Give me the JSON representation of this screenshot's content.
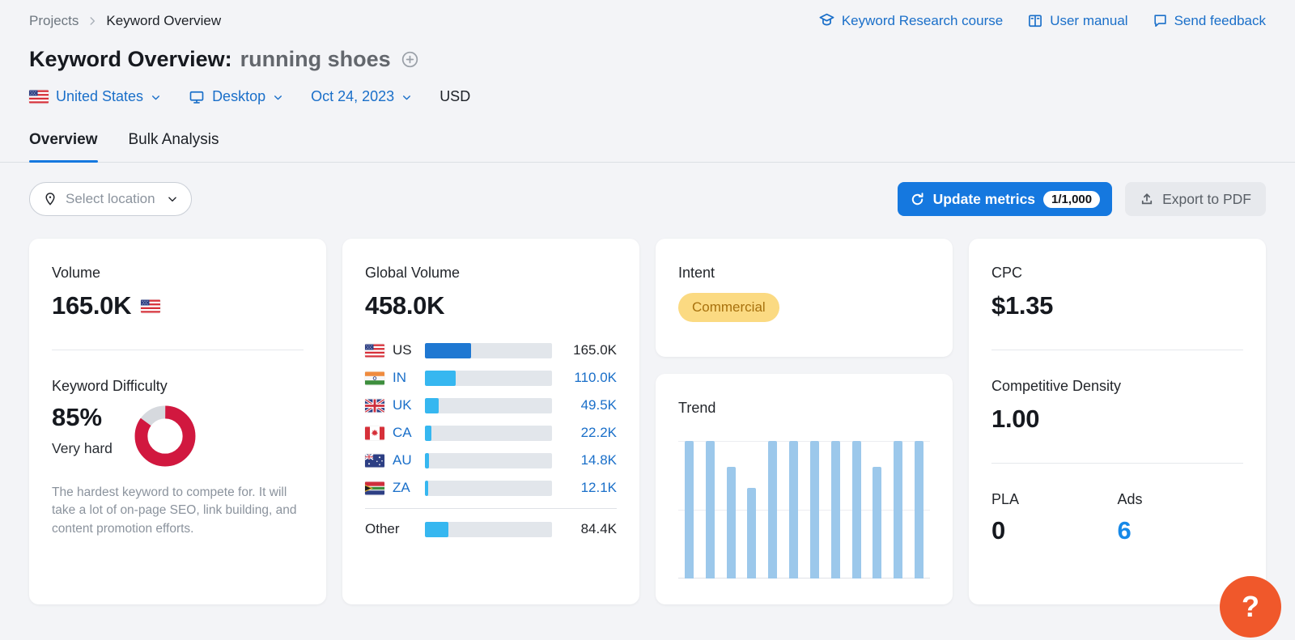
{
  "breadcrumb": {
    "items": [
      {
        "label": "Projects"
      },
      {
        "label": "Keyword Overview"
      }
    ]
  },
  "header_links": [
    {
      "label": "Keyword Research course",
      "icon": "graduation-cap-icon"
    },
    {
      "label": "User manual",
      "icon": "book-icon"
    },
    {
      "label": "Send feedback",
      "icon": "chat-bubble-icon"
    }
  ],
  "title": {
    "prefix": "Keyword Overview:",
    "keyword": "running shoes"
  },
  "filters": {
    "location": {
      "label": "United States",
      "flag": "us"
    },
    "device": {
      "label": "Desktop"
    },
    "date": {
      "label": "Oct 24, 2023"
    },
    "currency": {
      "label": "USD"
    }
  },
  "tabs": [
    {
      "label": "Overview",
      "active": true
    },
    {
      "label": "Bulk Analysis",
      "active": false
    }
  ],
  "toolbar": {
    "select_location": {
      "placeholder": "Select location"
    },
    "update_metrics": {
      "label": "Update metrics",
      "counter": "1/1,000"
    },
    "export_pdf": {
      "label": "Export to PDF"
    }
  },
  "cards": {
    "volume": {
      "title": "Volume",
      "value": "165.0K",
      "flag": "us"
    },
    "keyword_difficulty": {
      "title": "Keyword Difficulty",
      "percent": "85%",
      "level": "Very hard",
      "description": "The hardest keyword to compete for. It will take a lot of on-page SEO, link building, and content promotion efforts."
    },
    "global_volume": {
      "title": "Global Volume",
      "value": "458.0K",
      "rows": [
        {
          "code": "US",
          "flag": "us",
          "value": "165.0K",
          "fraction": 0.36,
          "dark_bar": true,
          "link": false
        },
        {
          "code": "IN",
          "flag": "in",
          "value": "110.0K",
          "fraction": 0.24,
          "dark_bar": false,
          "link": true
        },
        {
          "code": "UK",
          "flag": "uk",
          "value": "49.5K",
          "fraction": 0.108,
          "dark_bar": false,
          "link": true
        },
        {
          "code": "CA",
          "flag": "ca",
          "value": "22.2K",
          "fraction": 0.048,
          "dark_bar": false,
          "link": true
        },
        {
          "code": "AU",
          "flag": "au",
          "value": "14.8K",
          "fraction": 0.032,
          "dark_bar": false,
          "link": true
        },
        {
          "code": "ZA",
          "flag": "za",
          "value": "12.1K",
          "fraction": 0.026,
          "dark_bar": false,
          "link": true
        },
        {
          "code": "Other",
          "flag": null,
          "value": "84.4K",
          "fraction": 0.184,
          "dark_bar": false,
          "link": false,
          "divider_before": true
        }
      ]
    },
    "intent": {
      "title": "Intent",
      "badge": "Commercial"
    },
    "trend": {
      "title": "Trend"
    },
    "cpc": {
      "title": "CPC",
      "value": "$1.35"
    },
    "competitive_density": {
      "title": "Competitive Density",
      "value": "1.00"
    },
    "pla": {
      "title": "PLA",
      "value": "0"
    },
    "ads": {
      "title": "Ads",
      "value": "6"
    }
  },
  "help_button": {
    "label": "?"
  },
  "colors": {
    "page_bg": "#f3f4f7",
    "link_blue": "#1a6fc9",
    "button_blue": "#1578df",
    "value_blue": "#1789e8",
    "bar_dark_blue": "#1f78d2",
    "bar_sky_blue": "#36b7f0",
    "trend_bar": "#9cc8eb",
    "difficulty_red": "#d1183f",
    "donut_track": "#d6d9de",
    "intent_badge_bg": "#fbda82",
    "intent_badge_text": "#a8710d",
    "help_orange": "#f0582b"
  },
  "chart_data": [
    {
      "type": "pie",
      "name": "keyword-difficulty-donut",
      "title": "Keyword Difficulty",
      "labels": [
        "difficulty",
        "remaining"
      ],
      "values": [
        85,
        15
      ],
      "colors": [
        "#d1183f",
        "#d6d9de"
      ],
      "donut": true
    },
    {
      "type": "bar",
      "name": "global-volume-by-country",
      "orientation": "horizontal",
      "categories": [
        "US",
        "IN",
        "UK",
        "CA",
        "AU",
        "ZA",
        "Other"
      ],
      "values": [
        165000,
        110000,
        49500,
        22200,
        14800,
        12100,
        84400
      ],
      "value_labels": [
        "165.0K",
        "110.0K",
        "49.5K",
        "22.2K",
        "14.8K",
        "12.1K",
        "84.4K"
      ],
      "total": 458000,
      "total_label": "458.0K"
    },
    {
      "type": "bar",
      "name": "trend",
      "title": "Trend",
      "x": [
        1,
        2,
        3,
        4,
        5,
        6,
        7,
        8,
        9,
        10,
        11,
        12
      ],
      "values": [
        100,
        100,
        81,
        66,
        100,
        100,
        100,
        100,
        100,
        81,
        100,
        100
      ],
      "ylim": [
        0,
        100
      ],
      "grid": true,
      "legend": false
    }
  ]
}
